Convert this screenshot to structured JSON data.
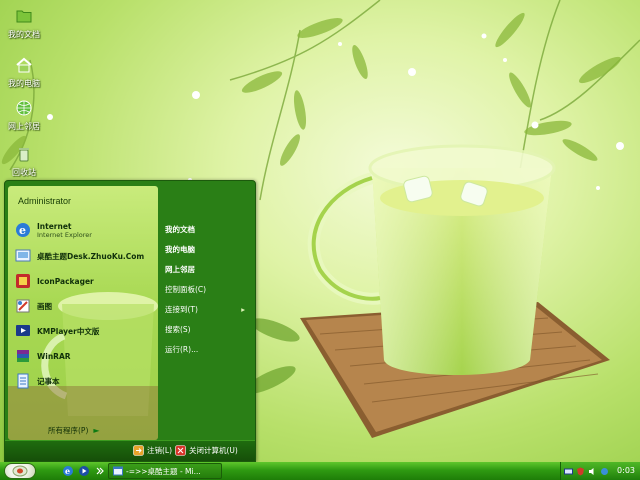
{
  "desktop": {
    "icons": [
      {
        "label": "我的文档",
        "icon": "folder-icon"
      },
      {
        "label": "我的电脑",
        "icon": "home-computer-icon"
      },
      {
        "label": "网上邻居",
        "icon": "network-globe-icon"
      },
      {
        "label": "回收站",
        "icon": "recycle-bin-icon"
      }
    ]
  },
  "start_menu": {
    "user_name": "Administrator",
    "pinned": [
      {
        "title": "Internet",
        "subtitle": "Internet Explorer",
        "icon": "internet-explorer-icon"
      },
      {
        "title": "桌酷主题Desk.ZhuoKu.Com",
        "subtitle": "",
        "icon": "desktop-theme-icon"
      },
      {
        "title": "IconPackager",
        "subtitle": "",
        "icon": "iconpackager-icon"
      },
      {
        "title": "画图",
        "subtitle": "",
        "icon": "paint-icon"
      },
      {
        "title": "KMPlayer中文版",
        "subtitle": "",
        "icon": "kmplayer-icon"
      },
      {
        "title": "WinRAR",
        "subtitle": "",
        "icon": "winrar-icon"
      },
      {
        "title": "记事本",
        "subtitle": "",
        "icon": "notepad-icon"
      }
    ],
    "all_programs": "所有程序(P)",
    "right_items": [
      {
        "label": "我的文档",
        "bold": true,
        "arrow": ""
      },
      {
        "label": "我的电脑",
        "bold": true,
        "arrow": ""
      },
      {
        "label": "网上邻居",
        "bold": true,
        "arrow": ""
      },
      {
        "label": "控制面板(C)",
        "bold": false,
        "arrow": ""
      },
      {
        "label": "连接到(T)",
        "bold": false,
        "arrow": "▸"
      },
      {
        "label": "搜索(S)",
        "bold": false,
        "arrow": ""
      },
      {
        "label": "运行(R)...",
        "bold": false,
        "arrow": ""
      }
    ],
    "logoff": "注销(L)",
    "shutdown": "关闭计算机(U)"
  },
  "taskbar": {
    "task_label": "-=>>桌酷主题 - Mi...",
    "clock": "0:03"
  },
  "colors": {
    "taskbar_green": "#2f9a12",
    "menu_green": "#2a7f16",
    "wallpaper_green": "#b8e06a"
  }
}
